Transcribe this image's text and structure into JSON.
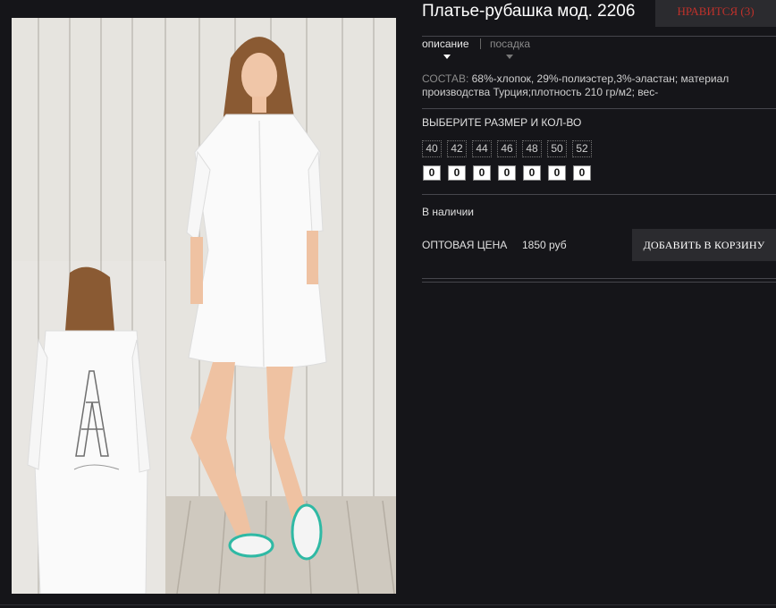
{
  "product": {
    "title": "Платье-рубашка мод. 2206",
    "like_button": "НРАВИТСЯ (3)",
    "photo_alt": "фото платья-рубашки"
  },
  "tabs": [
    {
      "label": "описание",
      "active": true
    },
    {
      "label": "посадка",
      "active": false
    }
  ],
  "composition": {
    "label": "СОСТАВ:",
    "text": " 68%-хлопок, 29%-полиэстер,3%-эластан; материал производства Турция;плотность 210 гр/м2; вес-"
  },
  "sizes": {
    "title": "ВЫБЕРИТЕ РАЗМЕР И КОЛ-ВО",
    "values": [
      "40",
      "42",
      "44",
      "46",
      "48",
      "50",
      "52"
    ],
    "quantities": [
      "0",
      "0",
      "0",
      "0",
      "0",
      "0",
      "0"
    ]
  },
  "stock": "В наличии",
  "price": {
    "label": "ОПТОВАЯ ЦЕНА",
    "value": "1850 руб"
  },
  "cart_button": "ДОБАВИТЬ В КОРЗИНУ",
  "colors": {
    "background": "#151519",
    "accent_red": "#c0312b",
    "button_bg": "#2b2b2f"
  }
}
